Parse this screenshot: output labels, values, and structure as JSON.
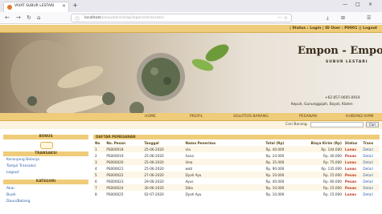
{
  "browser": {
    "tab_title": "VIVAT SUBUR LESTARI",
    "tab_close": "×",
    "new_tab": "+",
    "url_host": "localhost",
    "url_path": "/penjualan/rekap/laporan/transaksi",
    "url_right": "··· ☆",
    "controls": [
      "—",
      "□",
      "×"
    ],
    "toolbar_icons": [
      "⤓",
      "⊞",
      "☰"
    ]
  },
  "statusbar": {
    "text": "| Status : Login | ID User : P0001 || Logout"
  },
  "banner": {
    "brand": "Empon - Empon",
    "subtitle": "SUBUR LESTARI",
    "phone": "+62 857-0605-0919",
    "address": "Kepuh, Gununggajah, Bayat, Klaten"
  },
  "menu": [
    {
      "label": "HOME"
    },
    {
      "label": "PROFIL"
    },
    {
      "label": "SOLUTIOS BARANG"
    },
    {
      "label": "PESANAN"
    },
    {
      "label": "HUBUNGI KAMI"
    }
  ],
  "search": {
    "label": "Cari Barang",
    "placeholder": "",
    "button": "Cari"
  },
  "sidebar": {
    "member_header": "BONUS",
    "transaksi_header": "TRANSAKSI",
    "transaksi_links": [
      "Keranjang Belanja",
      "Tampil Transaksi",
      "Logout"
    ],
    "kategori_header": "KATEGORI",
    "kategori_links": [
      "Akar",
      "Buah",
      "Daun/Batang"
    ]
  },
  "content": {
    "header": "DAFTAR PEMESANAN",
    "columns": [
      "No",
      "No. Pesan",
      "Tanggal",
      "Nama Penerima",
      "Total (Rp)",
      "Biaya Kirim (Rp)",
      "Status",
      "Trans"
    ],
    "rows": [
      {
        "no": "1",
        "kode": "PS000018",
        "tanggal": "25-06-2020",
        "nama": "nia",
        "total": "Rp. 40.000",
        "biaya": "Rp. 144.000",
        "status": "Lunas",
        "aksi": "Detail"
      },
      {
        "no": "2",
        "kode": "PS000019",
        "tanggal": "25-06-2020",
        "nama": "hana",
        "total": "Rp. 24.000",
        "biaya": "Rp. 40.000",
        "status": "Pesan",
        "aksi": "Detail"
      },
      {
        "no": "3",
        "kode": "PS000020",
        "tanggal": "25-06-2020",
        "nama": "lima",
        "total": "Rp. 35.000",
        "biaya": "Rp. 75.000",
        "status": "Lunas",
        "aksi": "Detail"
      },
      {
        "no": "4",
        "kode": "PS000021",
        "tanggal": "25-06-2020",
        "nama": "wati",
        "total": "Rp. 90.000",
        "biaya": "Rp. 135.000",
        "status": "Lunas",
        "aksi": "Detail"
      },
      {
        "no": "5",
        "kode": "PS000022",
        "tanggal": "27-06-2020",
        "nama": "Dyah Ayu",
        "total": "Rp. 10.000",
        "biaya": "Rp. 15.000",
        "status": "Pesan",
        "aksi": "Detail"
      },
      {
        "no": "6",
        "kode": "PS000023",
        "tanggal": "29-06-2020",
        "nama": "Ayus",
        "total": "Rp. 40.000",
        "biaya": "Rp. 60.000",
        "status": "Pesan",
        "aksi": "Detail"
      },
      {
        "no": "7",
        "kode": "PS000024",
        "tanggal": "30-06-2020",
        "nama": "Dika",
        "total": "Rp. 10.000",
        "biaya": "Rp. 15.000",
        "status": "Pesan",
        "aksi": "Detail"
      },
      {
        "no": "8",
        "kode": "PS000025",
        "tanggal": "02-07-2020",
        "nama": "Dyah Ayu",
        "total": "Rp. 10.000",
        "biaya": "Rp. 15.000",
        "status": "Lunas",
        "aksi": "Detail"
      }
    ]
  },
  "colors": {
    "accent": "#efcc7a",
    "link": "#2b5fa8",
    "status": "#c0392b"
  }
}
